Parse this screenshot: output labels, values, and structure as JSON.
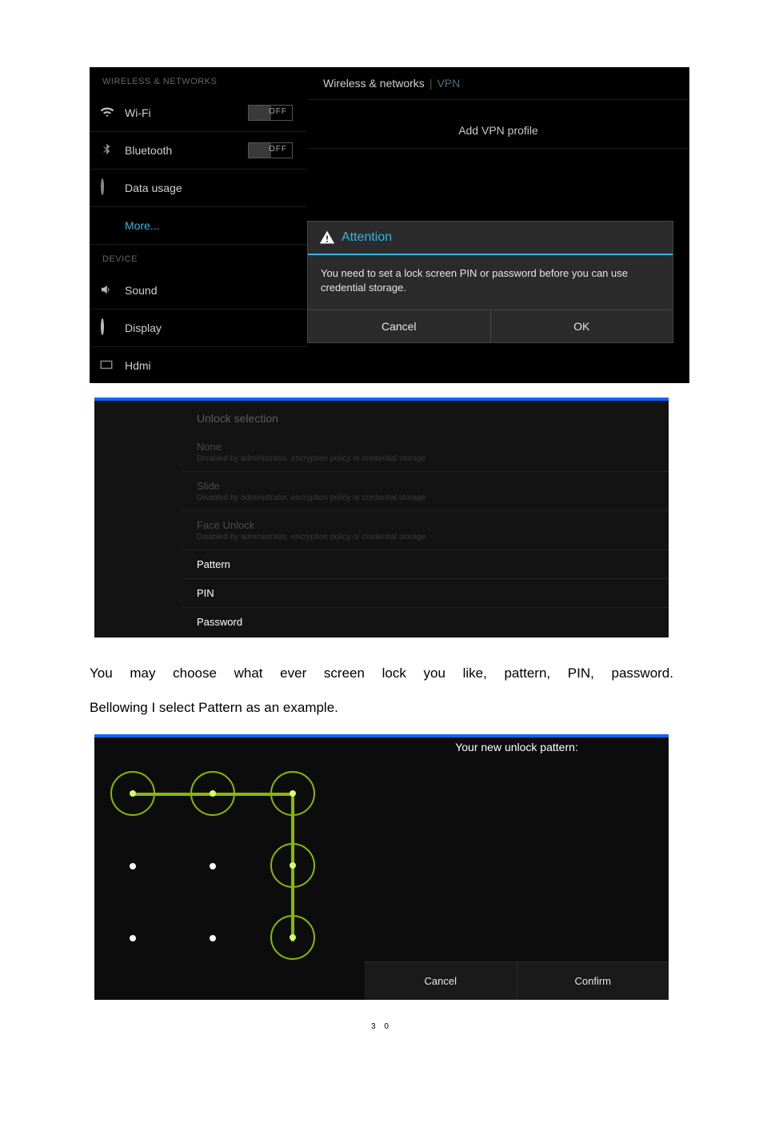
{
  "shot1": {
    "cat_wn": "WIRELESS & NETWORKS",
    "wifi": "Wi-Fi",
    "wifi_toggle": "OFF",
    "bt": "Bluetooth",
    "bt_toggle": "OFF",
    "data_usage": "Data usage",
    "more": "More...",
    "cat_device": "DEVICE",
    "sound": "Sound",
    "display": "Display",
    "hdmi": "Hdmi",
    "panel_title": "Wireless & networks",
    "panel_sep": "|",
    "panel_sub": "VPN",
    "add_vpn": "Add VPN profile",
    "dialog": {
      "title": "Attention",
      "message": "You need to set a lock screen PIN or password before you can use credential storage.",
      "cancel": "Cancel",
      "ok": "OK"
    }
  },
  "shot2": {
    "title": "Unlock selection",
    "disabled_sub": "Disabled by administrator, encryption policy or credential storage",
    "opts": {
      "none": "None",
      "slide": "Slide",
      "face": "Face Unlock",
      "pattern": "Pattern",
      "pin": "PIN",
      "pwd": "Password"
    }
  },
  "body": {
    "p1": "You may choose what ever screen lock you like, pattern, PIN, password.",
    "p2": "Bellowing I select Pattern as an example."
  },
  "shot3": {
    "header": "Your new unlock pattern:",
    "cancel": "Cancel",
    "confirm": "Confirm"
  },
  "page_number": "3 0"
}
